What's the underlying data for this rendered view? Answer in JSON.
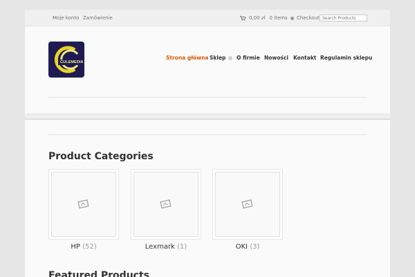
{
  "topbar": {
    "my_account": "Moje konto",
    "order": "Zamówienie",
    "cart_amount": "0,00 zł",
    "cart_items": "0 items",
    "checkout": "Checkout",
    "search_placeholder": "Search Products"
  },
  "logo": {
    "text": "CULEMEDIA"
  },
  "nav": [
    {
      "label": "Strona główna",
      "active": true
    },
    {
      "label": "Sklep",
      "has_submenu": true
    },
    {
      "label": "O firmie"
    },
    {
      "label": "Nowości"
    },
    {
      "label": "Kontakt"
    },
    {
      "label": "Regulamin sklepu"
    }
  ],
  "main": {
    "categories_title": "Product Categories",
    "categories": [
      {
        "name": "HP",
        "count": "(52)"
      },
      {
        "name": "Lexmark",
        "count": "(1)"
      },
      {
        "name": "OKI",
        "count": "(3)"
      }
    ],
    "featured_title": "Featured Products"
  },
  "colors": {
    "accent": "#d35c00",
    "logo_bg": "#1f1b52",
    "logo_ring": "#e8d22a"
  },
  "icons": {
    "cart": "cart-icon",
    "checkout": "checkout-dot-icon",
    "placeholder": "image-placeholder-icon"
  }
}
